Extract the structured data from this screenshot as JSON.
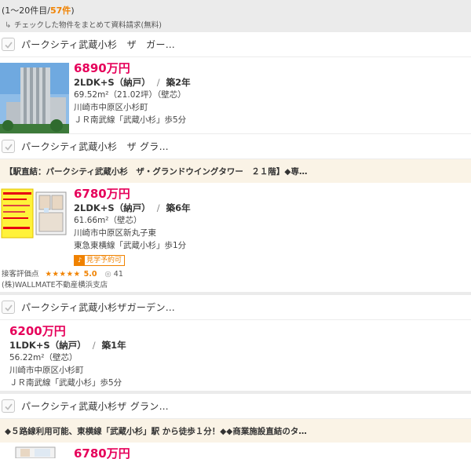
{
  "result_count": {
    "prefix": "(1〜20件目/",
    "total": "57件",
    "suffix": ")"
  },
  "bulk_request": {
    "label": "チェックした物件をまとめて資料請求(無料)"
  },
  "cards": [
    {
      "title": "パークシティ武蔵小杉　ザ　ガー…",
      "price": "6890万円",
      "layout": "2LDK+S（納戸）",
      "age": "築2年",
      "area": "69.52m²（21.02坪）（壁芯）",
      "address": "川崎市中原区小杉町",
      "station": "ＪＲ南武線「武蔵小杉」歩5分"
    },
    {
      "title": "パークシティ武蔵小杉　ザ グラ…",
      "banner": "【駅直結：パークシティ武蔵小杉　ザ・グランドウイングタワー　２１階】◆専…",
      "price": "6780万円",
      "layout": "2LDK+S（納戸）",
      "age": "築6年",
      "area": "61.66m²（壁芯）",
      "address": "川崎市中原区新丸子東",
      "station": "東急東横線「武蔵小杉」歩1分",
      "badge": "見学予約可",
      "rating_label": "接客評価点",
      "stars": "★★★★★",
      "score": "5.0",
      "comments": "41",
      "agent": "(株)WALLMATE不動産横浜支店"
    },
    {
      "title": "パークシティ武蔵小杉ザガーデン…",
      "price": "6200万円",
      "layout": "1LDK+S（納戸）",
      "age": "築1年",
      "area": "56.22m²（壁芯）",
      "address": "川崎市中原区小杉町",
      "station": "ＪＲ南武線「武蔵小杉」歩5分"
    },
    {
      "title": "パークシティ武蔵小杉ザ グラン…",
      "banner": "◆５路線利用可能、東横線「武蔵小杉」駅 から徒歩１分！◆◆商業施設直結のタ…",
      "price": "6780万円"
    }
  ],
  "layout_separator": "/",
  "colors": {
    "price": "#e6005a",
    "accent": "#f08200",
    "banner_bg": "#faf3e6"
  }
}
